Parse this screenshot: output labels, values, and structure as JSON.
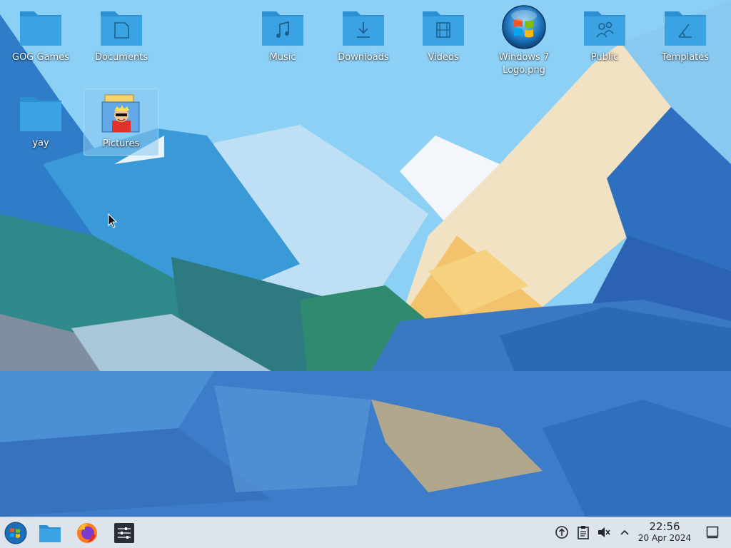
{
  "desktop": {
    "icons": [
      {
        "label": "GOG Games",
        "icon": "folder-icon"
      },
      {
        "label": "Documents",
        "icon": "folder-documents-icon"
      },
      {
        "label": "Music",
        "icon": "folder-music-icon"
      },
      {
        "label": "Downloads",
        "icon": "folder-downloads-icon"
      },
      {
        "label": "Videos",
        "icon": "folder-videos-icon"
      },
      {
        "label": "Windows 7 Logo.png",
        "icon": "windows-logo-image-icon"
      },
      {
        "label": "Public",
        "icon": "folder-public-icon"
      },
      {
        "label": "Templates",
        "icon": "folder-templates-icon"
      },
      {
        "label": "yay",
        "icon": "folder-icon"
      },
      {
        "label": "Pictures",
        "icon": "folder-pictures-icon",
        "selected": true
      }
    ]
  },
  "taskbar": {
    "launchers": [
      {
        "name": "start-menu",
        "icon": "windows-start-icon"
      },
      {
        "name": "file-manager",
        "icon": "folder-icon"
      },
      {
        "name": "firefox",
        "icon": "firefox-icon"
      },
      {
        "name": "system-settings",
        "icon": "settings-sliders-icon"
      }
    ],
    "tray": [
      {
        "name": "update",
        "icon": "update-arrow-icon"
      },
      {
        "name": "clipboard",
        "icon": "clipboard-icon"
      },
      {
        "name": "volume-muted",
        "icon": "speaker-muted-icon"
      },
      {
        "name": "show-hidden",
        "icon": "chevron-up-icon"
      }
    ],
    "clock": {
      "time": "22:56",
      "date": "20 Apr 2024"
    },
    "show_desktop_icon": "show-desktop-icon"
  },
  "colors": {
    "folder_body": "#3aa3e3",
    "folder_tab": "#2b8fd0",
    "taskbar_bg": "#dde4ec",
    "clock_text": "#232629"
  }
}
